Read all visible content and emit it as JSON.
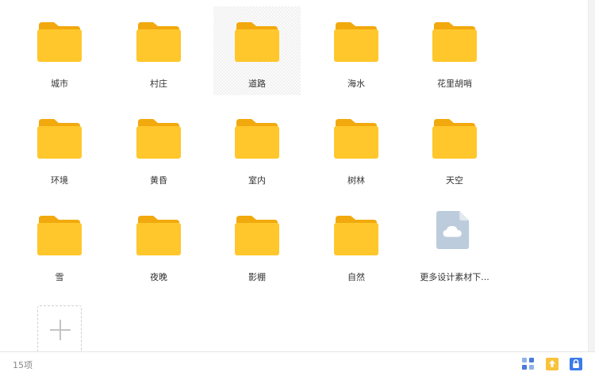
{
  "items": [
    {
      "label": "城市",
      "type": "folder"
    },
    {
      "label": "村庄",
      "type": "folder"
    },
    {
      "label": "道路",
      "type": "folder"
    },
    {
      "label": "海水",
      "type": "folder"
    },
    {
      "label": "花里胡哨",
      "type": "folder"
    },
    {
      "label": "环境",
      "type": "folder"
    },
    {
      "label": "黄昏",
      "type": "folder"
    },
    {
      "label": "室内",
      "type": "folder"
    },
    {
      "label": "树林",
      "type": "folder"
    },
    {
      "label": "天空",
      "type": "folder"
    },
    {
      "label": "雪",
      "type": "folder"
    },
    {
      "label": "夜晚",
      "type": "folder"
    },
    {
      "label": "影棚",
      "type": "folder"
    },
    {
      "label": "自然",
      "type": "folder"
    },
    {
      "label": "更多设计素材下...",
      "type": "cloud-file"
    }
  ],
  "status": {
    "count": "15项"
  },
  "colors": {
    "folder_body": "#FFC72C",
    "folder_tab": "#F2A90D",
    "cloud_file": "#BDCCDC",
    "grid_icon": "#4A7BD8",
    "upload_bg": "#F8C23A",
    "lock_bg": "#3B7BEA"
  },
  "icons": {
    "folder": "folder-icon",
    "cloud_file": "cloud-file-icon",
    "add": "plus-icon",
    "grid_view": "grid-view-icon",
    "upload": "upload-icon",
    "lock": "lock-icon"
  }
}
